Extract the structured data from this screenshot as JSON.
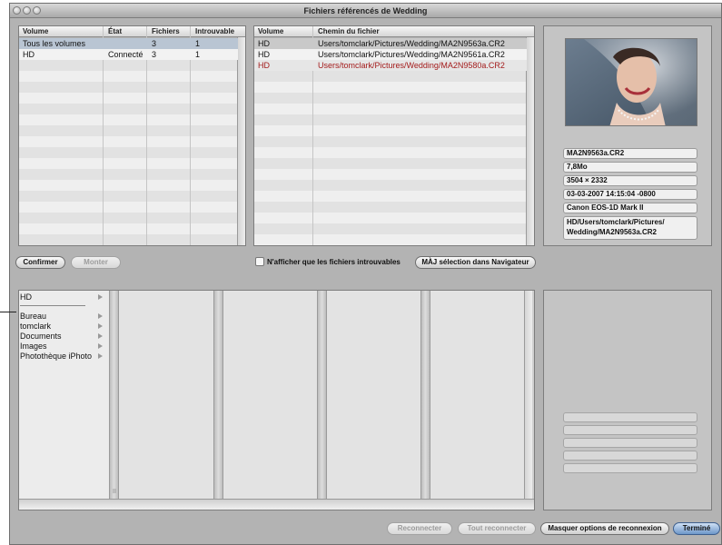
{
  "window": {
    "title": "Fichiers référencés de Wedding"
  },
  "volumes_table": {
    "headers": [
      "Volume",
      "État",
      "Fichiers",
      "Introuvable"
    ],
    "rows": [
      [
        "Tous les volumes",
        "",
        "3",
        "1"
      ],
      [
        "HD",
        "Connecté",
        "3",
        "1"
      ]
    ]
  },
  "files_table": {
    "headers": [
      "Volume",
      "Chemin du fichier"
    ],
    "rows": [
      [
        "HD",
        "Users/tomclark/Pictures/Wedding/MA2N9563a.CR2"
      ],
      [
        "HD",
        "Users/tomclark/Pictures/Wedding/MA2N9561a.CR2"
      ],
      [
        "HD",
        "Users/tomclark/Pictures/Wedding/MA2N9580a.CR2"
      ]
    ],
    "missing_color": "#a31b1b"
  },
  "info": {
    "filename": "MA2N9563a.CR2",
    "size": "7,8Mo",
    "dimensions": "3504 × 2332",
    "date": "03-03-2007 14:15:04 -0800",
    "camera": "Canon EOS-1D Mark II",
    "path": "HD/Users/tomclark/Pictures/\nWedding/MA2N9563a.CR2"
  },
  "buttons": {
    "confirm": "Confirmer",
    "mount": "Monter",
    "update_selection": "MÀJ sélection dans Navigateur",
    "reconnect": "Reconnecter",
    "reconnect_all": "Tout reconnecter",
    "hide_options": "Masquer options de reconnexion",
    "done": "Terminé"
  },
  "checkbox": {
    "label": "N'afficher que les fichiers introuvables",
    "checked": false
  },
  "browser": {
    "items": [
      "HD",
      "Bureau",
      "tomclark",
      "Documents",
      "Images",
      "Photothèque iPhoto"
    ]
  }
}
